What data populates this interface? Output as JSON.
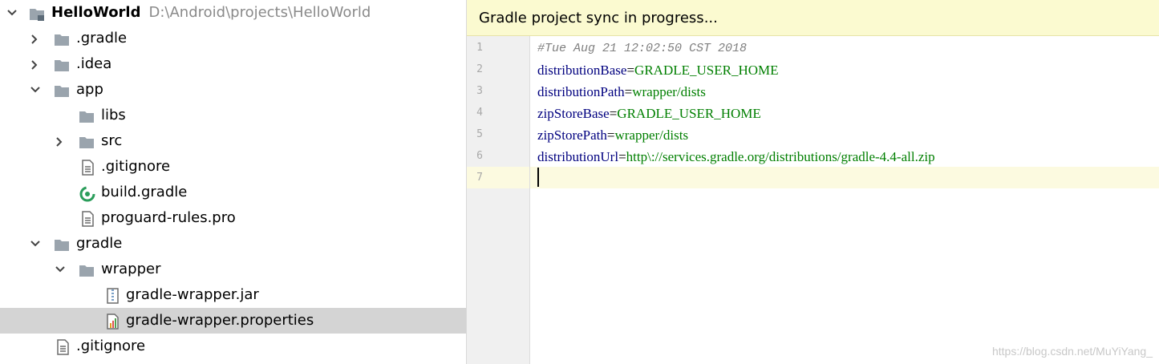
{
  "project_tree": {
    "root": {
      "name": "HelloWorld",
      "path": "D:\\Android\\projects\\HelloWorld"
    },
    "items": [
      {
        "label": ".gradle"
      },
      {
        "label": ".idea"
      },
      {
        "label": "app"
      },
      {
        "label": "libs"
      },
      {
        "label": "src"
      },
      {
        "label": ".gitignore"
      },
      {
        "label": "build.gradle"
      },
      {
        "label": "proguard-rules.pro"
      },
      {
        "label": "gradle"
      },
      {
        "label": "wrapper"
      },
      {
        "label": "gradle-wrapper.jar"
      },
      {
        "label": "gradle-wrapper.properties"
      },
      {
        "label": ".gitignore"
      }
    ]
  },
  "editor": {
    "banner": "Gradle project sync in progress...",
    "line_numbers": [
      "1",
      "2",
      "3",
      "4",
      "5",
      "6",
      "7"
    ],
    "comment": "#Tue Aug 21 12:02:50 CST 2018",
    "lines": [
      {
        "key": "distributionBase",
        "eq": "=",
        "value": "GRADLE_USER_HOME"
      },
      {
        "key": "distributionPath",
        "eq": "=",
        "value": "wrapper/dists"
      },
      {
        "key": "zipStoreBase",
        "eq": "=",
        "value": "GRADLE_USER_HOME"
      },
      {
        "key": "zipStorePath",
        "eq": "=",
        "value": "wrapper/dists"
      },
      {
        "key": "distributionUrl",
        "eq": "=",
        "value": "http\\://services.gradle.org/distributions/gradle-4.4-all.zip"
      }
    ]
  },
  "watermark": "https://blog.csdn.net/MuYiYang_",
  "colors": {
    "folder": "#9aa4ad",
    "selection": "#d4d4d4",
    "banner": "#fbfad0",
    "key": "#00007f",
    "value": "#007f00"
  }
}
